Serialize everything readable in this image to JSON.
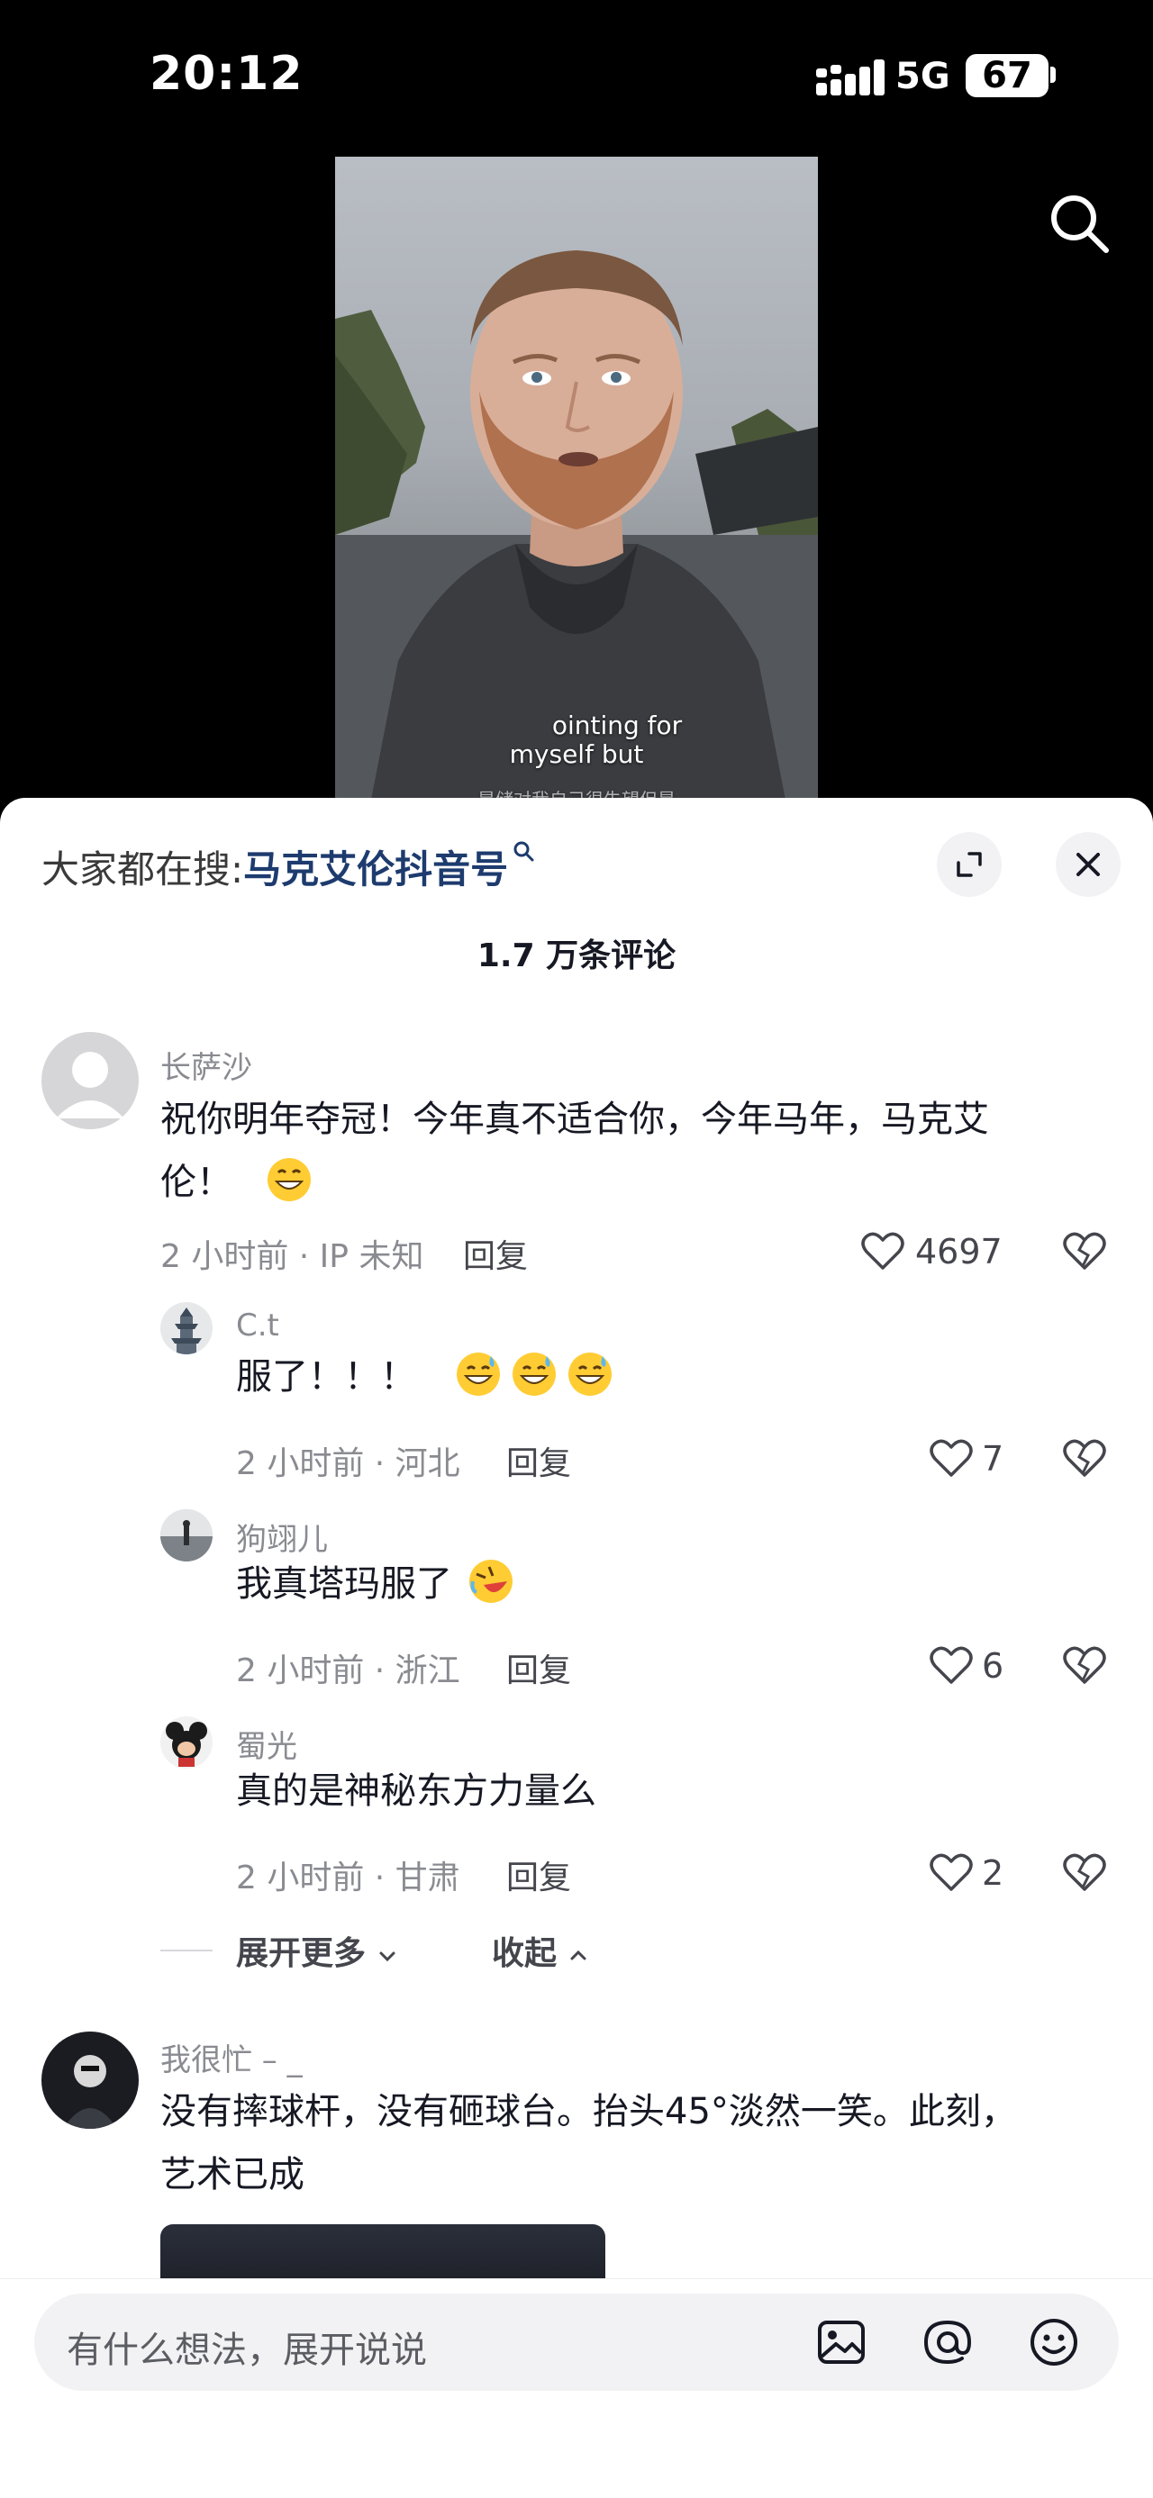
{
  "status_bar": {
    "time": "20:12",
    "network": "5G",
    "battery": "67"
  },
  "video": {
    "caption_line_1": "myself but",
    "caption_fragment": "ointing for",
    "caption_line_2": "是储对我自己很失望但是"
  },
  "sheet": {
    "hot_search_label": "大家都在搜:",
    "hot_search_term": "马克艾伦抖音号",
    "comment_count": "1.7 万条评论"
  },
  "comments": [
    {
      "author": "长萨沙",
      "text_line_1": "祝你明年夺冠！今年真不适合你，今年马年，马克艾",
      "text_line_2": "伦！",
      "meta": "2 小时前 · IP 未知",
      "reply_label": "回复",
      "likes": "4697",
      "emoji": "grinning-face"
    },
    {
      "author": "C.t",
      "text": "服了！！！",
      "meta": "2 小时前 · 河北",
      "reply_label": "回复",
      "likes": "7",
      "emoji": "sweat-smile"
    },
    {
      "author": "狗翊儿",
      "text": "我真塔玛服了",
      "meta": "2 小时前 · 浙江",
      "reply_label": "回复",
      "likes": "6",
      "emoji": "rolling-laughing"
    },
    {
      "author": "蜀光",
      "text": "真的是神秘东方力量么",
      "meta": "2 小时前 · 甘肃",
      "reply_label": "回复",
      "likes": "2"
    },
    {
      "author": "我很忙 – _",
      "text_line_1": "没有摔球杆，没有砸球台。抬头45°淡然一笑。此刻，",
      "text_line_2": "艺术已成"
    }
  ],
  "thread_controls": {
    "expand_more": "展开更多",
    "collapse": "收起"
  },
  "input": {
    "placeholder": "有什么想法，展开说说"
  },
  "colors": {
    "link": "#1d3b6e",
    "muted": "#8a8b91",
    "text": "#161823"
  }
}
